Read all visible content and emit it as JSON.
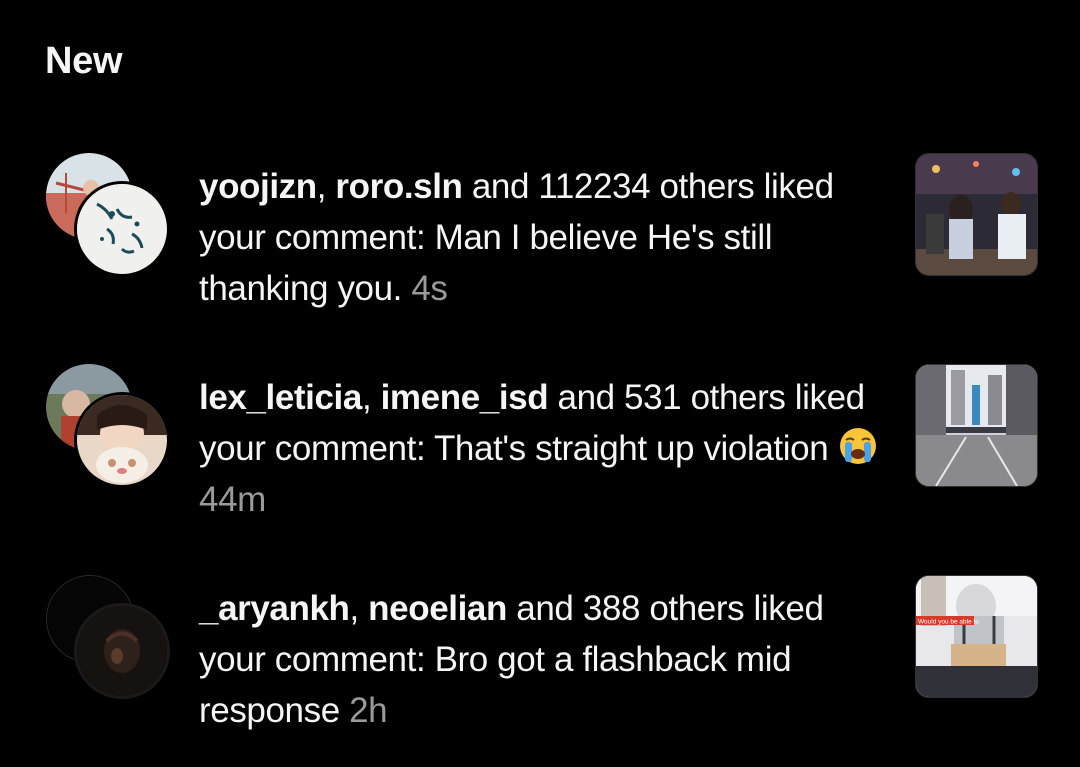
{
  "section": {
    "title": "New"
  },
  "notifications": [
    {
      "user1": "yoojizn",
      "separator": ", ",
      "user2": "roro.sln",
      "message": " and 112234 others liked your comment: Man I believe He's still thanking you. ",
      "time": "4s"
    },
    {
      "user1": "lex_leticia",
      "separator": ", ",
      "user2": "imene_isd",
      "message": " and 531 others liked your comment: That's straight up violation ",
      "emoji": "loudly-crying-face",
      "time": "44m"
    },
    {
      "user1": "_aryankh",
      "separator": ", ",
      "user2": "neoelian",
      "message": " and 388 others liked your comment: Bro got a flashback mid response ",
      "time": "2h",
      "thumb_caption": "Would you be able to"
    }
  ],
  "colors": {
    "background": "#000000",
    "text": "#f5f5f5",
    "timestamp": "#9a9a9a"
  }
}
